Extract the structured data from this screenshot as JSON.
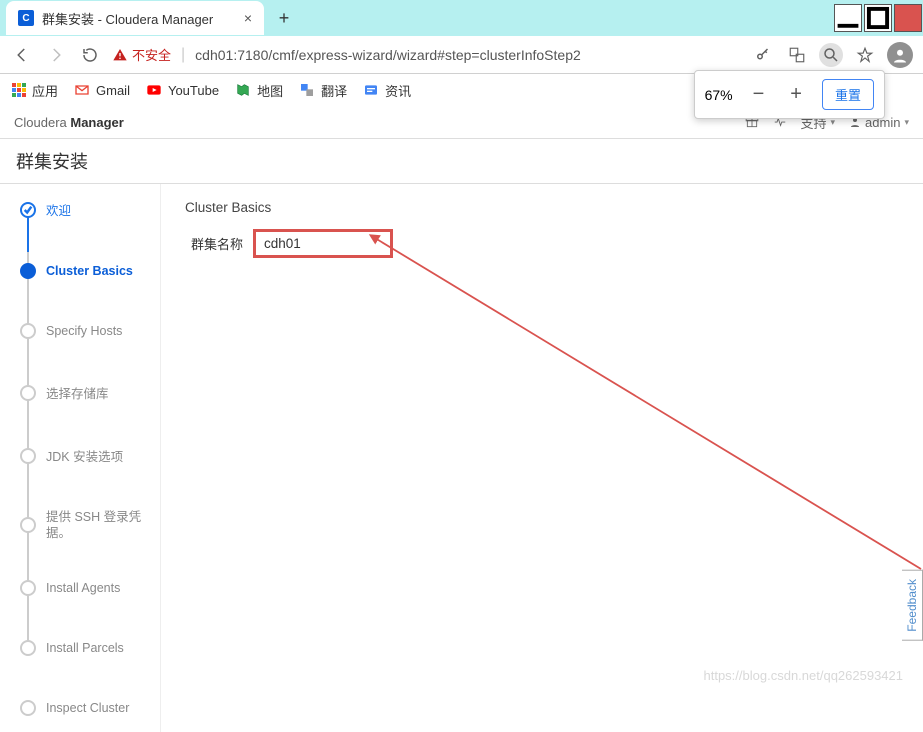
{
  "browser": {
    "tab_title": "群集安装 - Cloudera Manager",
    "url_insecure_label": "不安全",
    "url": "cdh01:7180/cmf/express-wizard/wizard#step=clusterInfoStep2"
  },
  "bookmarks": {
    "apps": "应用",
    "items": [
      "Gmail",
      "YouTube",
      "地图",
      "翻译",
      "资讯"
    ]
  },
  "zoom": {
    "value": "67%",
    "reset_label": "重置"
  },
  "header": {
    "brand_light": "Cloudera ",
    "brand_bold": "Manager",
    "support": "支持",
    "user": "admin"
  },
  "page": {
    "title": "群集安装"
  },
  "wizard": {
    "steps": [
      {
        "label": "欢迎",
        "state": "completed"
      },
      {
        "label": "Cluster Basics",
        "state": "active"
      },
      {
        "label": "Specify Hosts",
        "state": "pending"
      },
      {
        "label": "选择存储库",
        "state": "pending"
      },
      {
        "label": "JDK 安装选项",
        "state": "pending"
      },
      {
        "label": "提供 SSH 登录凭据。",
        "state": "pending"
      },
      {
        "label": "Install Agents",
        "state": "pending"
      },
      {
        "label": "Install Parcels",
        "state": "pending"
      },
      {
        "label": "Inspect Cluster",
        "state": "pending"
      }
    ]
  },
  "content": {
    "section_title": "Cluster Basics",
    "cluster_name_label": "群集名称",
    "cluster_name_value": "cdh01"
  },
  "feedback_label": "Feedback",
  "watermark": "https://blog.csdn.net/qq262593421"
}
